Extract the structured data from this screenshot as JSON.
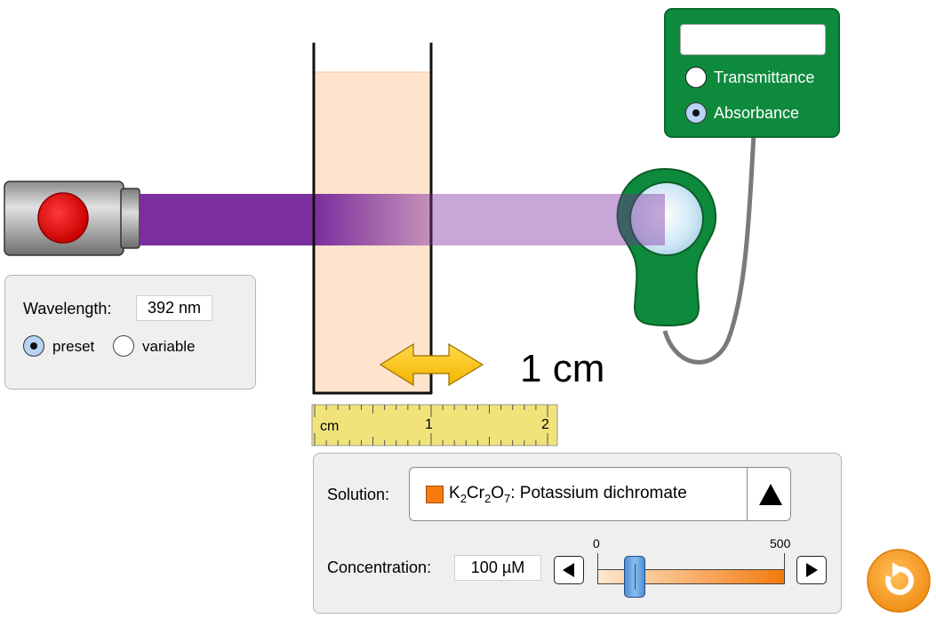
{
  "colors": {
    "beam": "#7b2e9e",
    "solution": "#ffe3cc",
    "meter_green": "#0e8a3c",
    "ruler": "#efe37a",
    "swatch": "#f57c0c",
    "slider_thumb": "#5b9ad9",
    "reset_orange": "#f59a1b"
  },
  "icons": {
    "light_source": "flashlight-icon",
    "detector": "detector-probe-icon",
    "width_arrow": "double-arrow-icon",
    "reset": "reset-icon",
    "combo": "triangle-up-icon",
    "slider_left": "triangle-left-icon",
    "slider_right": "triangle-right-icon"
  },
  "meter": {
    "display_value": "",
    "options": [
      {
        "label": "Transmittance",
        "selected": false
      },
      {
        "label": "Absorbance",
        "selected": true
      }
    ]
  },
  "wavelength": {
    "label": "Wavelength:",
    "value": "392 nm",
    "options": [
      {
        "label": "preset",
        "selected": true
      },
      {
        "label": "variable",
        "selected": false
      }
    ]
  },
  "cuvette": {
    "width_label": "1 cm",
    "width_cm": 1
  },
  "ruler": {
    "unit_label": "cm",
    "ticks": [
      "1",
      "2"
    ]
  },
  "solution": {
    "label": "Solution:",
    "formula": {
      "K": "K",
      "sub1": "2",
      "Cr": "Cr",
      "sub2": "2",
      "O": "O",
      "sub3": "7"
    },
    "name": ": Potassium dichromate"
  },
  "concentration": {
    "label": "Concentration:",
    "value_text": "100 µM",
    "value": 100,
    "min": 0,
    "max": 500,
    "min_label": "0",
    "max_label": "500"
  }
}
